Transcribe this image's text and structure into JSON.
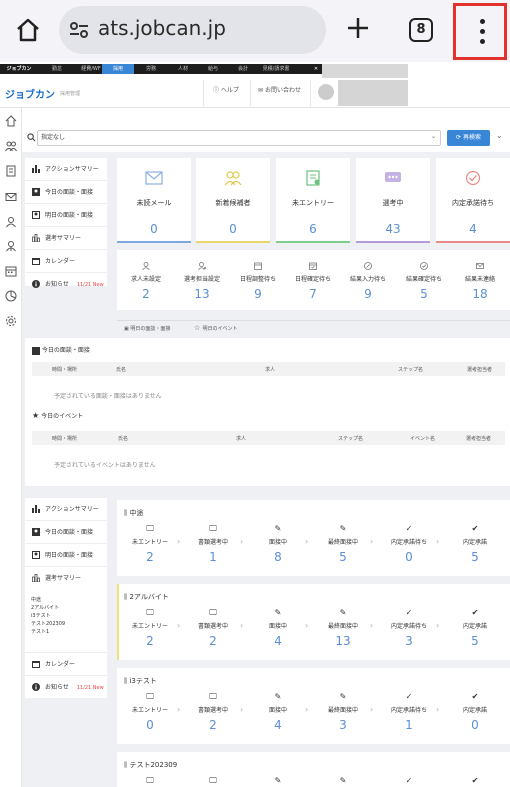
{
  "browser": {
    "url": "ats.jobcan.jp",
    "tab_count": "8"
  },
  "topnav": [
    "ジョブカン",
    "勤怠",
    "経費/WF",
    "採用",
    "労務",
    "人材",
    "給与",
    "会計",
    "見積/請求書"
  ],
  "header": {
    "logo": "ジョブカン",
    "logo_sub": "採用管理",
    "help": "ヘルプ",
    "contact": "お問い合わせ"
  },
  "search": {
    "placeholder": "指定なし",
    "button": "再検索"
  },
  "left_menu": {
    "action_summary": "アクションサマリー",
    "today_interview": "今日の面談・面接",
    "tomorrow_interview": "明日の面談・面接",
    "selection_summary": "選考サマリー",
    "calendar": "カレンダー",
    "notice": "お知らせ",
    "notice_date": "11/21 New"
  },
  "cards": [
    {
      "label": "未読メール",
      "value": "0",
      "color": "#7fa8e0"
    },
    {
      "label": "新着候補者",
      "value": "0",
      "color": "#e8d66a"
    },
    {
      "label": "未エントリー",
      "value": "6",
      "color": "#7ccf8a"
    },
    {
      "label": "選考中",
      "value": "43",
      "color": "#b49ad8"
    },
    {
      "label": "内定承諾待ち",
      "value": "4",
      "color": "#e88a8a"
    }
  ],
  "stats": [
    {
      "label": "求人未設定",
      "value": "2"
    },
    {
      "label": "選考担当設定",
      "value": "13"
    },
    {
      "label": "日程調整待ち",
      "value": "9"
    },
    {
      "label": "日程確定待ち",
      "value": "7"
    },
    {
      "label": "結果入力待ち",
      "value": "9"
    },
    {
      "label": "結果確定待ち",
      "value": "5"
    },
    {
      "label": "結果未連絡",
      "value": "18"
    }
  ],
  "subtabs": {
    "tomorrow": "明日の面談・面接",
    "event": "明日のイベント"
  },
  "today_section": {
    "title": "今日の面談・面接",
    "cols": [
      "時間・場所",
      "氏名",
      "求人",
      "ステップ名",
      "選考担当者"
    ],
    "empty": "予定されている面談・面接はありません"
  },
  "event_section": {
    "title": "今日のイベント",
    "cols": [
      "時間・場所",
      "氏名",
      "求人",
      "ステップ名",
      "イベント名",
      "選考担当者"
    ],
    "empty": "予定されているイベントはありません"
  },
  "left_menu2": {
    "action_summary": "アクションサマリー",
    "today_interview": "今日の面談・面接",
    "tomorrow_interview": "明日の面談・面接",
    "selection_summary": "選考サマリー",
    "summary_items": [
      "中途",
      "2アルバイト",
      "i3テスト",
      "テスト202309",
      "テスト1"
    ],
    "calendar": "カレンダー",
    "notice": "お知らせ",
    "notice_date": "11/21 New"
  },
  "pipeline_labels": [
    "未エントリー",
    "書類選考中",
    "面接中",
    "最終面接中",
    "内定承諾待ち",
    "内定承諾"
  ],
  "pipelines": [
    {
      "name": "中途",
      "values": [
        "2",
        "1",
        "8",
        "5",
        "0",
        "5"
      ]
    },
    {
      "name": "2アルバイト",
      "values": [
        "2",
        "2",
        "4",
        "13",
        "3",
        "5"
      ]
    },
    {
      "name": "i3テスト",
      "values": [
        "0",
        "2",
        "4",
        "3",
        "1",
        "0"
      ]
    },
    {
      "name": "テスト202309",
      "values": []
    }
  ]
}
